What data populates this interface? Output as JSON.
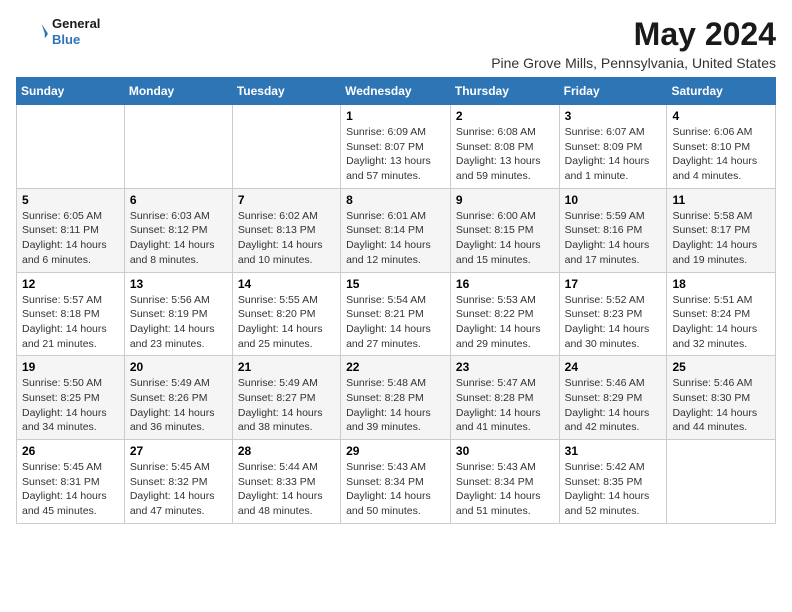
{
  "header": {
    "logo_line1": "General",
    "logo_line2": "Blue",
    "month": "May 2024",
    "location": "Pine Grove Mills, Pennsylvania, United States"
  },
  "weekdays": [
    "Sunday",
    "Monday",
    "Tuesday",
    "Wednesday",
    "Thursday",
    "Friday",
    "Saturday"
  ],
  "weeks": [
    [
      {
        "day": "",
        "info": ""
      },
      {
        "day": "",
        "info": ""
      },
      {
        "day": "",
        "info": ""
      },
      {
        "day": "1",
        "info": "Sunrise: 6:09 AM\nSunset: 8:07 PM\nDaylight: 13 hours\nand 57 minutes."
      },
      {
        "day": "2",
        "info": "Sunrise: 6:08 AM\nSunset: 8:08 PM\nDaylight: 13 hours\nand 59 minutes."
      },
      {
        "day": "3",
        "info": "Sunrise: 6:07 AM\nSunset: 8:09 PM\nDaylight: 14 hours\nand 1 minute."
      },
      {
        "day": "4",
        "info": "Sunrise: 6:06 AM\nSunset: 8:10 PM\nDaylight: 14 hours\nand 4 minutes."
      }
    ],
    [
      {
        "day": "5",
        "info": "Sunrise: 6:05 AM\nSunset: 8:11 PM\nDaylight: 14 hours\nand 6 minutes."
      },
      {
        "day": "6",
        "info": "Sunrise: 6:03 AM\nSunset: 8:12 PM\nDaylight: 14 hours\nand 8 minutes."
      },
      {
        "day": "7",
        "info": "Sunrise: 6:02 AM\nSunset: 8:13 PM\nDaylight: 14 hours\nand 10 minutes."
      },
      {
        "day": "8",
        "info": "Sunrise: 6:01 AM\nSunset: 8:14 PM\nDaylight: 14 hours\nand 12 minutes."
      },
      {
        "day": "9",
        "info": "Sunrise: 6:00 AM\nSunset: 8:15 PM\nDaylight: 14 hours\nand 15 minutes."
      },
      {
        "day": "10",
        "info": "Sunrise: 5:59 AM\nSunset: 8:16 PM\nDaylight: 14 hours\nand 17 minutes."
      },
      {
        "day": "11",
        "info": "Sunrise: 5:58 AM\nSunset: 8:17 PM\nDaylight: 14 hours\nand 19 minutes."
      }
    ],
    [
      {
        "day": "12",
        "info": "Sunrise: 5:57 AM\nSunset: 8:18 PM\nDaylight: 14 hours\nand 21 minutes."
      },
      {
        "day": "13",
        "info": "Sunrise: 5:56 AM\nSunset: 8:19 PM\nDaylight: 14 hours\nand 23 minutes."
      },
      {
        "day": "14",
        "info": "Sunrise: 5:55 AM\nSunset: 8:20 PM\nDaylight: 14 hours\nand 25 minutes."
      },
      {
        "day": "15",
        "info": "Sunrise: 5:54 AM\nSunset: 8:21 PM\nDaylight: 14 hours\nand 27 minutes."
      },
      {
        "day": "16",
        "info": "Sunrise: 5:53 AM\nSunset: 8:22 PM\nDaylight: 14 hours\nand 29 minutes."
      },
      {
        "day": "17",
        "info": "Sunrise: 5:52 AM\nSunset: 8:23 PM\nDaylight: 14 hours\nand 30 minutes."
      },
      {
        "day": "18",
        "info": "Sunrise: 5:51 AM\nSunset: 8:24 PM\nDaylight: 14 hours\nand 32 minutes."
      }
    ],
    [
      {
        "day": "19",
        "info": "Sunrise: 5:50 AM\nSunset: 8:25 PM\nDaylight: 14 hours\nand 34 minutes."
      },
      {
        "day": "20",
        "info": "Sunrise: 5:49 AM\nSunset: 8:26 PM\nDaylight: 14 hours\nand 36 minutes."
      },
      {
        "day": "21",
        "info": "Sunrise: 5:49 AM\nSunset: 8:27 PM\nDaylight: 14 hours\nand 38 minutes."
      },
      {
        "day": "22",
        "info": "Sunrise: 5:48 AM\nSunset: 8:28 PM\nDaylight: 14 hours\nand 39 minutes."
      },
      {
        "day": "23",
        "info": "Sunrise: 5:47 AM\nSunset: 8:28 PM\nDaylight: 14 hours\nand 41 minutes."
      },
      {
        "day": "24",
        "info": "Sunrise: 5:46 AM\nSunset: 8:29 PM\nDaylight: 14 hours\nand 42 minutes."
      },
      {
        "day": "25",
        "info": "Sunrise: 5:46 AM\nSunset: 8:30 PM\nDaylight: 14 hours\nand 44 minutes."
      }
    ],
    [
      {
        "day": "26",
        "info": "Sunrise: 5:45 AM\nSunset: 8:31 PM\nDaylight: 14 hours\nand 45 minutes."
      },
      {
        "day": "27",
        "info": "Sunrise: 5:45 AM\nSunset: 8:32 PM\nDaylight: 14 hours\nand 47 minutes."
      },
      {
        "day": "28",
        "info": "Sunrise: 5:44 AM\nSunset: 8:33 PM\nDaylight: 14 hours\nand 48 minutes."
      },
      {
        "day": "29",
        "info": "Sunrise: 5:43 AM\nSunset: 8:34 PM\nDaylight: 14 hours\nand 50 minutes."
      },
      {
        "day": "30",
        "info": "Sunrise: 5:43 AM\nSunset: 8:34 PM\nDaylight: 14 hours\nand 51 minutes."
      },
      {
        "day": "31",
        "info": "Sunrise: 5:42 AM\nSunset: 8:35 PM\nDaylight: 14 hours\nand 52 minutes."
      },
      {
        "day": "",
        "info": ""
      }
    ]
  ]
}
